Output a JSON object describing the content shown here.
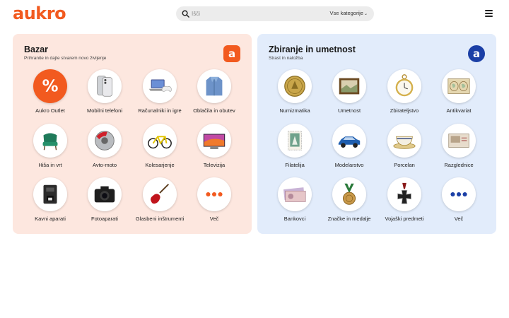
{
  "header": {
    "logo": "aukro",
    "search_placeholder": "Išči",
    "category_label": "Vse kategorije",
    "chevron": "⌄"
  },
  "colors": {
    "brand": "#f25a1f",
    "collect_badge": "#1b3fa6",
    "bazar_bg": "#fde7df",
    "collect_bg": "#e2ecfb"
  },
  "bazar": {
    "title": "Bazar",
    "subtitle": "Prihranite in dajte stvarem novo življenje",
    "badge": "a",
    "items": [
      {
        "label": "Aukro Outlet",
        "icon": "percent-icon"
      },
      {
        "label": "Mobilni telefoni",
        "icon": "phone-icon"
      },
      {
        "label": "Računalniki in igre",
        "icon": "laptop-icon"
      },
      {
        "label": "Oblačila in obutev",
        "icon": "jacket-icon"
      },
      {
        "label": "Hiša in vrt",
        "icon": "chair-icon"
      },
      {
        "label": "Avto-moto",
        "icon": "brake-icon"
      },
      {
        "label": "Kolesarjenje",
        "icon": "bicycle-icon"
      },
      {
        "label": "Televizija",
        "icon": "tv-icon"
      },
      {
        "label": "Kavni aparati",
        "icon": "coffee-machine-icon"
      },
      {
        "label": "Fotoaparati",
        "icon": "camera-icon"
      },
      {
        "label": "Glasbeni inštrumenti",
        "icon": "guitar-icon"
      },
      {
        "label": "Več",
        "icon": "more-icon"
      }
    ]
  },
  "collect": {
    "title": "Zbiranje in umetnost",
    "subtitle": "Strast in naložba",
    "badge": "a",
    "items": [
      {
        "label": "Numizmatika",
        "icon": "coin-icon"
      },
      {
        "label": "Umetnost",
        "icon": "painting-icon"
      },
      {
        "label": "Zbirateljstvo",
        "icon": "pocket-watch-icon"
      },
      {
        "label": "Antikvariat",
        "icon": "old-map-icon"
      },
      {
        "label": "Filatelija",
        "icon": "stamp-icon"
      },
      {
        "label": "Modelarstvo",
        "icon": "model-car-icon"
      },
      {
        "label": "Porcelan",
        "icon": "teacup-icon"
      },
      {
        "label": "Razglednice",
        "icon": "postcard-icon"
      },
      {
        "label": "Bankovci",
        "icon": "banknote-icon"
      },
      {
        "label": "Značke in medalje",
        "icon": "medal-icon"
      },
      {
        "label": "Vojaški predmeti",
        "icon": "iron-cross-icon"
      },
      {
        "label": "Več",
        "icon": "more-icon"
      }
    ]
  }
}
